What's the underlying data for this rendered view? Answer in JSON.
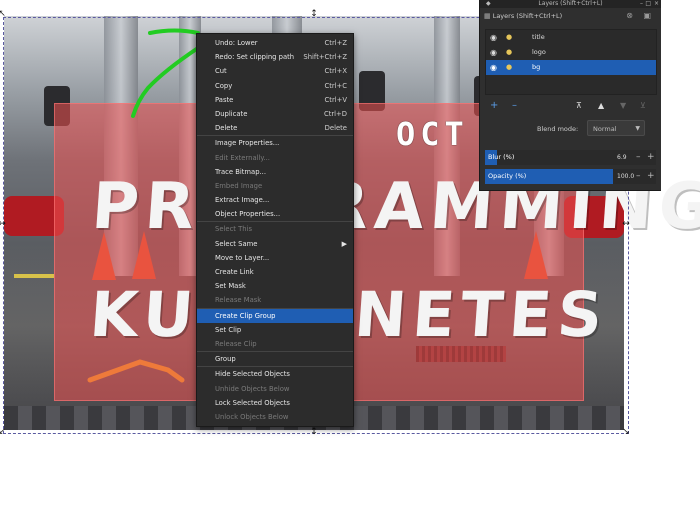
{
  "canvas": {
    "title_line1": "PROGRAMMING",
    "title_line2": "KUBERNETES",
    "badge_text": "OCT"
  },
  "context_menu": {
    "items": [
      {
        "label": "Undo: Lower",
        "shortcut": "Ctrl+Z",
        "disabled": false
      },
      {
        "label": "Redo: Set clipping path",
        "shortcut": "Shift+Ctrl+Z",
        "disabled": false
      },
      {
        "label": "Cut",
        "shortcut": "Ctrl+X",
        "disabled": false
      },
      {
        "label": "Copy",
        "shortcut": "Ctrl+C",
        "disabled": false
      },
      {
        "label": "Paste",
        "shortcut": "Ctrl+V",
        "disabled": false
      },
      {
        "label": "Duplicate",
        "shortcut": "Ctrl+D",
        "disabled": false
      },
      {
        "label": "Delete",
        "shortcut": "Delete",
        "disabled": false
      },
      {
        "label": "Image Properties...",
        "shortcut": "",
        "disabled": false
      },
      {
        "label": "Edit Externally...",
        "shortcut": "",
        "disabled": true
      },
      {
        "label": "Trace Bitmap...",
        "shortcut": "",
        "disabled": false
      },
      {
        "label": "Embed Image",
        "shortcut": "",
        "disabled": true
      },
      {
        "label": "Extract Image...",
        "shortcut": "",
        "disabled": false
      },
      {
        "label": "Object Properties...",
        "shortcut": "",
        "disabled": false
      },
      {
        "label": "Select This",
        "shortcut": "",
        "disabled": true
      },
      {
        "label": "Select Same",
        "shortcut": "",
        "disabled": false
      },
      {
        "label": "Move to Layer...",
        "shortcut": "",
        "disabled": false
      },
      {
        "label": "Create Link",
        "shortcut": "",
        "disabled": false
      },
      {
        "label": "Set Mask",
        "shortcut": "",
        "disabled": false
      },
      {
        "label": "Release Mask",
        "shortcut": "",
        "disabled": true
      },
      {
        "label": "Create Clip Group",
        "shortcut": "",
        "disabled": false
      },
      {
        "label": "Set Clip",
        "shortcut": "",
        "disabled": false
      },
      {
        "label": "Release Clip",
        "shortcut": "",
        "disabled": true
      },
      {
        "label": "Group",
        "shortcut": "",
        "disabled": false
      },
      {
        "label": "Hide Selected Objects",
        "shortcut": "",
        "disabled": false
      },
      {
        "label": "Unhide Objects Below",
        "shortcut": "",
        "disabled": true
      },
      {
        "label": "Lock Selected Objects",
        "shortcut": "",
        "disabled": false
      },
      {
        "label": "Unlock Objects Below",
        "shortcut": "",
        "disabled": true
      }
    ]
  },
  "layers_panel": {
    "window_title": "Layers (Shift+Ctrl+L)",
    "header_label": "Layers (Shift+Ctrl+L)",
    "layers": [
      {
        "name": "title",
        "selected": false
      },
      {
        "name": "logo",
        "selected": false
      },
      {
        "name": "bg",
        "selected": true
      }
    ],
    "blend_mode_label": "Blend mode:",
    "blend_mode_value": "Normal",
    "blur_label": "Blur (%)",
    "blur_value": "6.9",
    "blur_fraction": 0.069,
    "opacity_label": "Opacity (%)",
    "opacity_value": "100.0",
    "opacity_fraction": 1.0
  },
  "colors": {
    "menu_bg": "#2c2c2c",
    "highlight": "#1f5eb3",
    "overlay_red": "#ee5050",
    "annotation_green": "#22cc22"
  }
}
